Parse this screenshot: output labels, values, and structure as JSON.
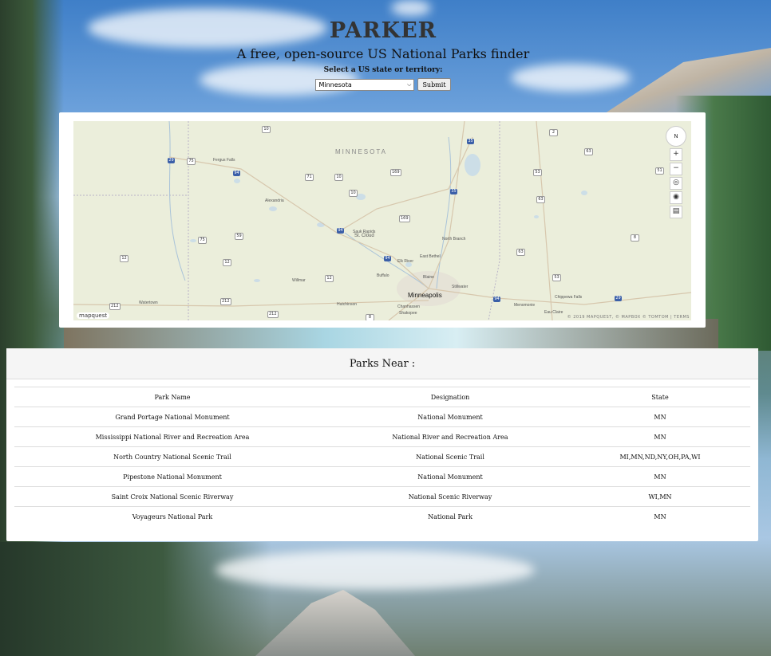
{
  "header": {
    "title": "PARKER",
    "subtitle": "A free, open-source US National Parks finder",
    "select_label": "Select a US state or territory:"
  },
  "form": {
    "selected_state": "Minnesota",
    "submit_label": "Submit"
  },
  "map": {
    "region_label": "MINNESOTA",
    "city_labels": [
      "Fergus Falls",
      "Alexandria",
      "Sauk Rapids",
      "St. Cloud",
      "Elk River",
      "Buffalo",
      "Willmar",
      "Hutchinson",
      "Watertown",
      "Minneapolis",
      "Chanhassen",
      "Shakopee",
      "Stillwater",
      "North Branch",
      "East Bethel",
      "Blaine",
      "Menomonie",
      "Eau Claire",
      "Chippewa Falls"
    ],
    "highway_labels": [
      "10",
      "29",
      "75",
      "94",
      "71",
      "10",
      "169",
      "35",
      "2",
      "63",
      "53",
      "51",
      "35",
      "63",
      "10",
      "169",
      "94",
      "59",
      "75",
      "12",
      "12",
      "94",
      "12",
      "8",
      "63",
      "53",
      "94",
      "212",
      "212",
      "212",
      "8",
      "29"
    ],
    "compass_label": "N",
    "zoom_in_label": "+",
    "zoom_out_label": "−",
    "attribution": "© 2019 MAPQUEST, © MAPBOX © TOMTOM | TERMS",
    "logo": "mapquest"
  },
  "parks": {
    "title": "Parks Near :",
    "columns": [
      "Park Name",
      "Designation",
      "State"
    ],
    "rows": [
      [
        "Grand Portage National Monument",
        "National Monument",
        "MN"
      ],
      [
        "Mississippi National River and Recreation Area",
        "National River and Recreation Area",
        "MN"
      ],
      [
        "North Country National Scenic Trail",
        "National Scenic Trail",
        "MI,MN,ND,NY,OH,PA,WI"
      ],
      [
        "Pipestone National Monument",
        "National Monument",
        "MN"
      ],
      [
        "Saint Croix National Scenic Riverway",
        "National Scenic Riverway",
        "WI,MN"
      ],
      [
        "Voyageurs National Park",
        "National Park",
        "MN"
      ]
    ]
  }
}
